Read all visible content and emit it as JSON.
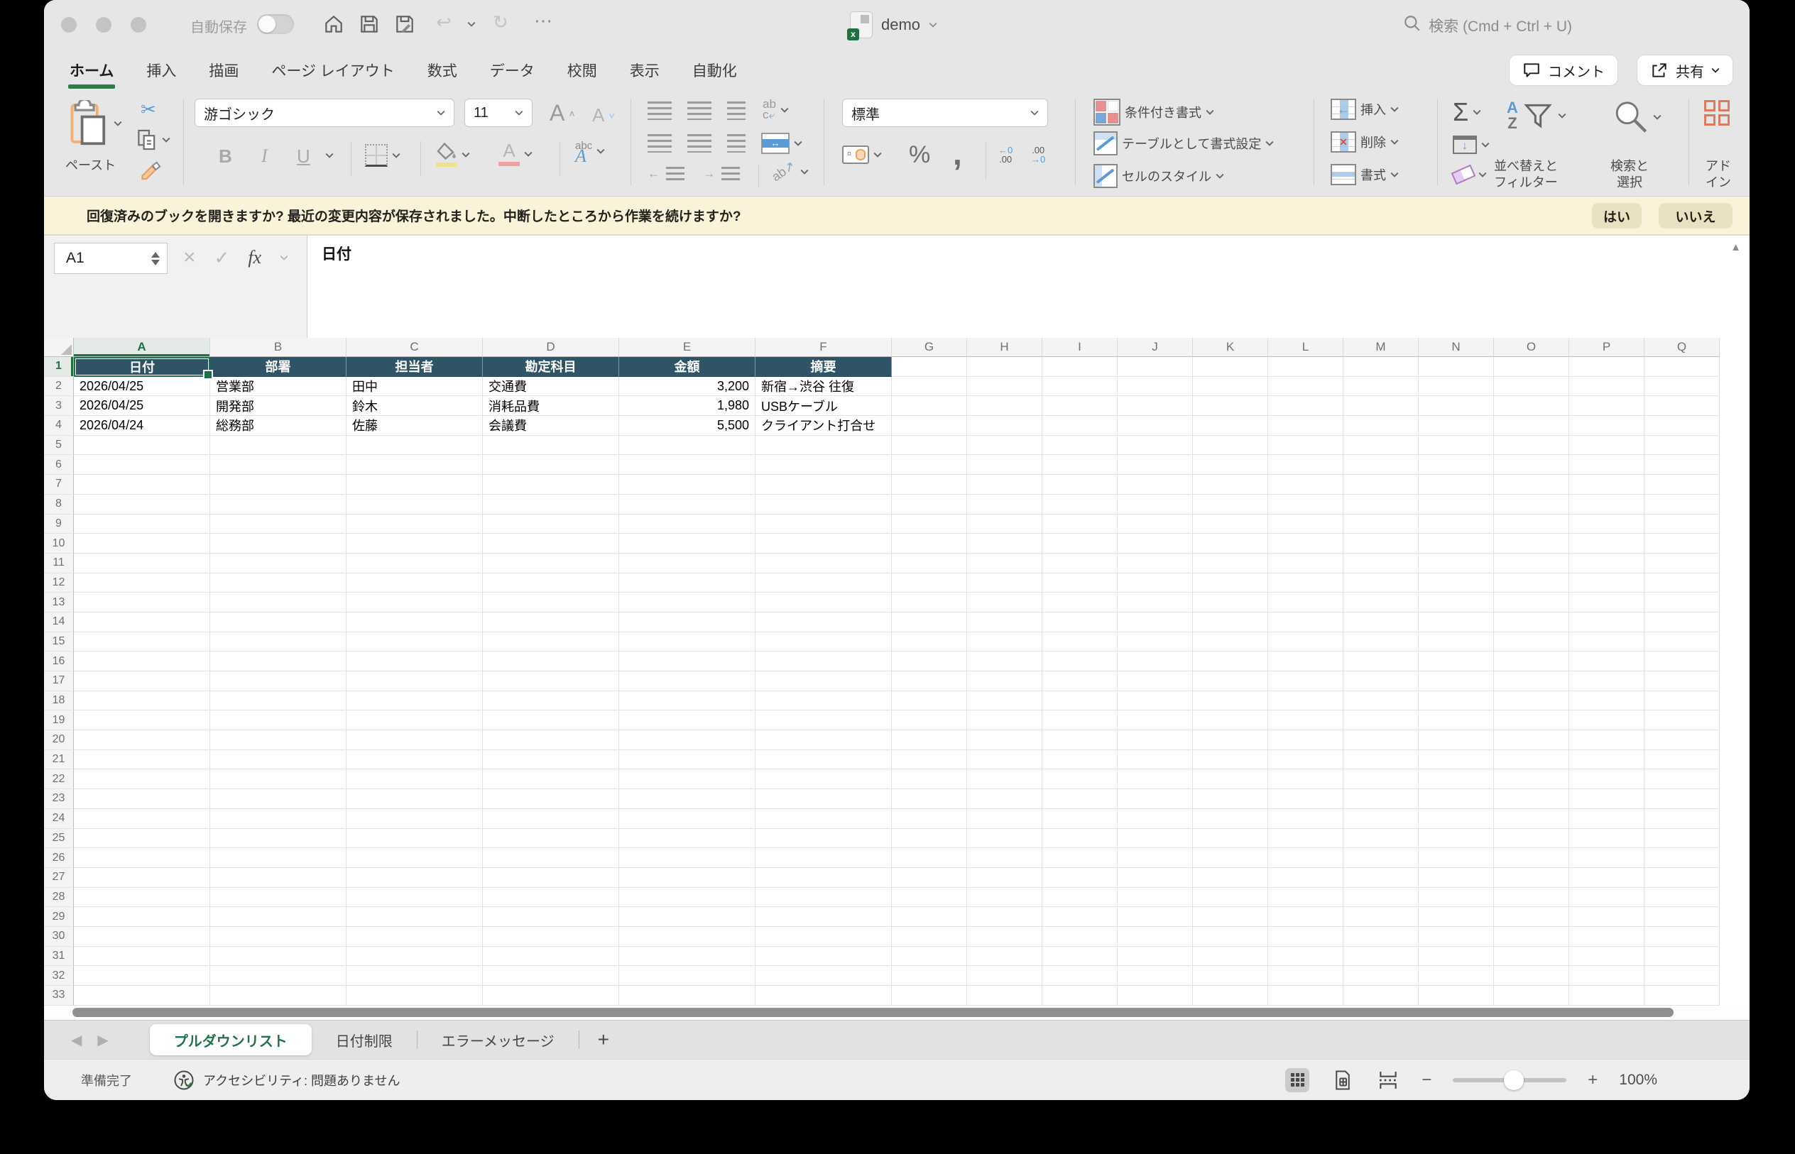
{
  "window": {
    "autosave_label": "自動保存",
    "title": "demo",
    "search_label": "検索 (Cmd + Ctrl + U)"
  },
  "ribbon": {
    "tabs": [
      {
        "label": "ホーム",
        "active": true
      },
      {
        "label": "挿入"
      },
      {
        "label": "描画"
      },
      {
        "label": "ページ レイアウト"
      },
      {
        "label": "数式"
      },
      {
        "label": "データ"
      },
      {
        "label": "校閲"
      },
      {
        "label": "表示"
      },
      {
        "label": "自動化"
      }
    ],
    "comment_label": "コメント",
    "share_label": "共有",
    "paste_label": "ペースト",
    "font_name": "游ゴシック",
    "font_size": "11",
    "number_format": "標準",
    "styles": [
      "条件付き書式",
      "テーブルとして書式設定",
      "セルのスタイル"
    ],
    "cells": [
      "挿入",
      "削除",
      "書式"
    ],
    "sort_filter_lines": [
      "並べ替えと",
      "フィルター"
    ],
    "find_select_lines": [
      "検索と",
      "選択"
    ],
    "addins_lines": [
      "アド",
      "イン"
    ]
  },
  "icons": {
    "bold": "B",
    "italic": "I",
    "underline": "U",
    "percent": "%",
    "comma": ",",
    "sum": "Σ",
    "fx": "fx",
    "font_up": "A",
    "font_down": "A",
    "inc_decimal_top": "←0",
    "inc_decimal_bottom": ".00",
    "dec_decimal_top": ".00",
    "dec_decimal_bottom": "→0"
  },
  "notification": {
    "message": "回復済みのブックを開きますか?  最近の変更内容が保存されました。中断したところから作業を続けますか?",
    "yes_label": "はい",
    "no_label": "いいえ"
  },
  "formula_bar": {
    "name_box": "A1",
    "value": "日付"
  },
  "grid": {
    "columns": [
      "A",
      "B",
      "C",
      "D",
      "E",
      "F",
      "G",
      "H",
      "I",
      "J",
      "K",
      "L",
      "M",
      "N",
      "O",
      "P",
      "Q"
    ],
    "selected_column": "A",
    "selected_row": 1,
    "selected_cell": "A1",
    "row_count": 33,
    "header_row": [
      "日付",
      "部署",
      "担当者",
      "勘定科目",
      "金額",
      "摘要"
    ],
    "rows": [
      [
        "2026/04/25",
        "営業部",
        "田中",
        "交通費",
        "3,200",
        "新宿→渋谷 往復"
      ],
      [
        "2026/04/25",
        "開発部",
        "鈴木",
        "消耗品費",
        "1,980",
        "USBケーブル"
      ],
      [
        "2026/04/24",
        "総務部",
        "佐藤",
        "会議費",
        "5,500",
        "クライアント打合せ"
      ]
    ]
  },
  "sheet_tabs": {
    "tabs": [
      {
        "label": "プルダウンリスト",
        "active": true
      },
      {
        "label": "日付制限"
      },
      {
        "label": "エラーメッセージ"
      }
    ],
    "add_label": "+"
  },
  "status_bar": {
    "ready_label": "準備完了",
    "accessibility_label": "アクセシビリティ: 問題ありません",
    "zoom_level": "100%"
  },
  "colors": {
    "excel_green": "#217346",
    "selection_green": "#1e7145",
    "table_header_bg": "#2f5466",
    "notice_bg": "#faf3da",
    "notice_button_bg": "#eae1c2"
  }
}
